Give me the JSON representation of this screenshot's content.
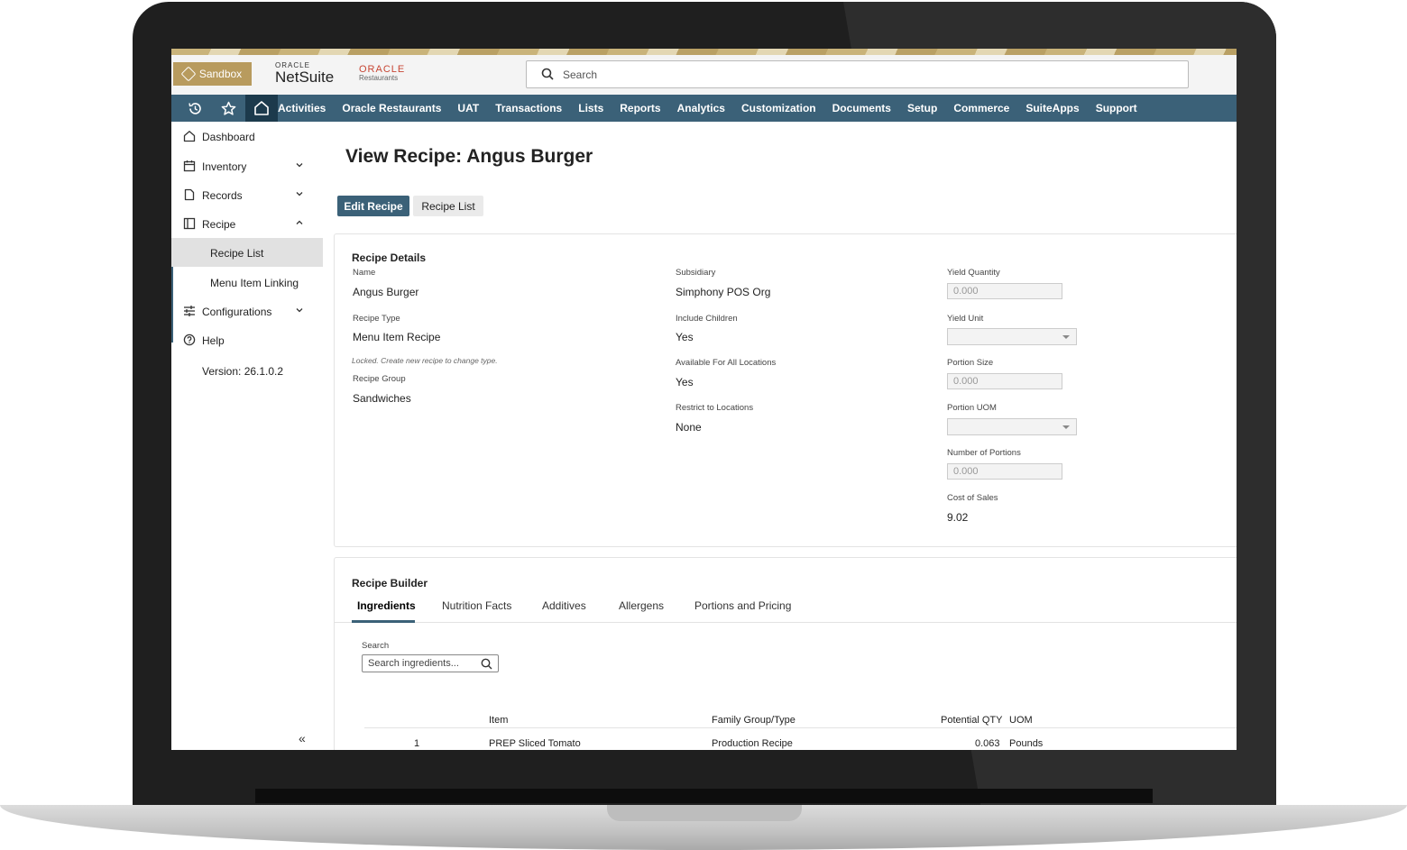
{
  "header": {
    "sandbox_label": "Sandbox",
    "logo_oracle": "ORACLE",
    "logo_netsuite": "NetSuite",
    "logo_oracle2": "ORACLE",
    "logo_restaurants": "Restaurants",
    "search_placeholder": "Search"
  },
  "nav": {
    "items": [
      "Activities",
      "Oracle Restaurants",
      "UAT",
      "Transactions",
      "Lists",
      "Reports",
      "Analytics",
      "Customization",
      "Documents",
      "Setup",
      "Commerce",
      "SuiteApps",
      "Support"
    ]
  },
  "sidebar": {
    "dashboard": "Dashboard",
    "inventory": "Inventory",
    "records": "Records",
    "recipe": "Recipe",
    "recipe_list": "Recipe List",
    "menu_item_linking": "Menu Item Linking",
    "configurations": "Configurations",
    "help": "Help",
    "version": "Version: 26.1.0.2",
    "collapse": "«"
  },
  "page": {
    "title": "View Recipe: Angus Burger",
    "edit_button": "Edit Recipe",
    "list_button": "Recipe List"
  },
  "details": {
    "section_title": "Recipe Details",
    "name_label": "Name",
    "name_value": "Angus Burger",
    "type_label": "Recipe Type",
    "type_value": "Menu Item Recipe",
    "type_note": "Locked. Create new recipe to change type.",
    "group_label": "Recipe Group",
    "group_value": "Sandwiches",
    "subsidiary_label": "Subsidiary",
    "subsidiary_value": "Simphony POS Org",
    "children_label": "Include Children",
    "children_value": "Yes",
    "all_locations_label": "Available For All Locations",
    "all_locations_value": "Yes",
    "restrict_label": "Restrict to Locations",
    "restrict_value": "None",
    "yield_qty_label": "Yield Quantity",
    "yield_qty_placeholder": "0.000",
    "yield_unit_label": "Yield Unit",
    "portion_size_label": "Portion Size",
    "portion_size_placeholder": "0.000",
    "portion_uom_label": "Portion UOM",
    "num_portions_label": "Number of Portions",
    "num_portions_placeholder": "0.000",
    "cost_label": "Cost of Sales",
    "cost_value": "9.02"
  },
  "builder": {
    "section_title": "Recipe Builder",
    "tabs": [
      "Ingredients",
      "Nutrition Facts",
      "Additives",
      "Allergens",
      "Portions and Pricing"
    ],
    "search_label": "Search",
    "search_placeholder": "Search ingredients...",
    "columns": [
      "Item",
      "Family Group/Type",
      "Potential QTY",
      "UOM"
    ],
    "rows": [
      {
        "num": "1",
        "item": "PREP Sliced Tomato",
        "family": "Production Recipe",
        "qty": "0.063",
        "uom": "Pounds"
      }
    ]
  },
  "colors": {
    "nav": "#3b6178",
    "primary_button": "#3b6178",
    "sandbox": "#b89b5e",
    "oracle_red": "#c74634"
  }
}
